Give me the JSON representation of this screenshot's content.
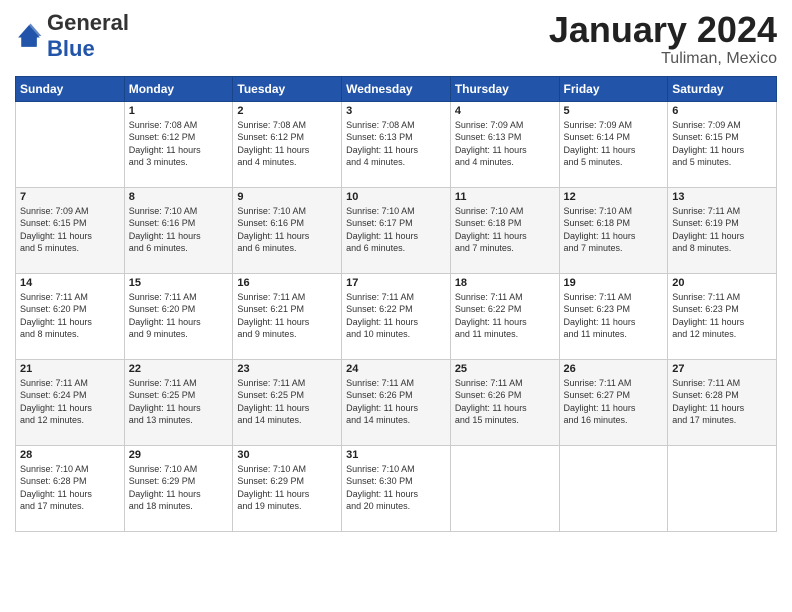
{
  "header": {
    "logo": {
      "general": "General",
      "blue": "Blue"
    },
    "title": "January 2024",
    "subtitle": "Tuliman, Mexico"
  },
  "calendar": {
    "days_of_week": [
      "Sunday",
      "Monday",
      "Tuesday",
      "Wednesday",
      "Thursday",
      "Friday",
      "Saturday"
    ],
    "weeks": [
      [
        {
          "day": "",
          "info": ""
        },
        {
          "day": "1",
          "info": "Sunrise: 7:08 AM\nSunset: 6:12 PM\nDaylight: 11 hours\nand 3 minutes."
        },
        {
          "day": "2",
          "info": "Sunrise: 7:08 AM\nSunset: 6:12 PM\nDaylight: 11 hours\nand 4 minutes."
        },
        {
          "day": "3",
          "info": "Sunrise: 7:08 AM\nSunset: 6:13 PM\nDaylight: 11 hours\nand 4 minutes."
        },
        {
          "day": "4",
          "info": "Sunrise: 7:09 AM\nSunset: 6:13 PM\nDaylight: 11 hours\nand 4 minutes."
        },
        {
          "day": "5",
          "info": "Sunrise: 7:09 AM\nSunset: 6:14 PM\nDaylight: 11 hours\nand 5 minutes."
        },
        {
          "day": "6",
          "info": "Sunrise: 7:09 AM\nSunset: 6:15 PM\nDaylight: 11 hours\nand 5 minutes."
        }
      ],
      [
        {
          "day": "7",
          "info": "Sunrise: 7:09 AM\nSunset: 6:15 PM\nDaylight: 11 hours\nand 5 minutes."
        },
        {
          "day": "8",
          "info": "Sunrise: 7:10 AM\nSunset: 6:16 PM\nDaylight: 11 hours\nand 6 minutes."
        },
        {
          "day": "9",
          "info": "Sunrise: 7:10 AM\nSunset: 6:16 PM\nDaylight: 11 hours\nand 6 minutes."
        },
        {
          "day": "10",
          "info": "Sunrise: 7:10 AM\nSunset: 6:17 PM\nDaylight: 11 hours\nand 6 minutes."
        },
        {
          "day": "11",
          "info": "Sunrise: 7:10 AM\nSunset: 6:18 PM\nDaylight: 11 hours\nand 7 minutes."
        },
        {
          "day": "12",
          "info": "Sunrise: 7:10 AM\nSunset: 6:18 PM\nDaylight: 11 hours\nand 7 minutes."
        },
        {
          "day": "13",
          "info": "Sunrise: 7:11 AM\nSunset: 6:19 PM\nDaylight: 11 hours\nand 8 minutes."
        }
      ],
      [
        {
          "day": "14",
          "info": "Sunrise: 7:11 AM\nSunset: 6:20 PM\nDaylight: 11 hours\nand 8 minutes."
        },
        {
          "day": "15",
          "info": "Sunrise: 7:11 AM\nSunset: 6:20 PM\nDaylight: 11 hours\nand 9 minutes."
        },
        {
          "day": "16",
          "info": "Sunrise: 7:11 AM\nSunset: 6:21 PM\nDaylight: 11 hours\nand 9 minutes."
        },
        {
          "day": "17",
          "info": "Sunrise: 7:11 AM\nSunset: 6:22 PM\nDaylight: 11 hours\nand 10 minutes."
        },
        {
          "day": "18",
          "info": "Sunrise: 7:11 AM\nSunset: 6:22 PM\nDaylight: 11 hours\nand 11 minutes."
        },
        {
          "day": "19",
          "info": "Sunrise: 7:11 AM\nSunset: 6:23 PM\nDaylight: 11 hours\nand 11 minutes."
        },
        {
          "day": "20",
          "info": "Sunrise: 7:11 AM\nSunset: 6:23 PM\nDaylight: 11 hours\nand 12 minutes."
        }
      ],
      [
        {
          "day": "21",
          "info": "Sunrise: 7:11 AM\nSunset: 6:24 PM\nDaylight: 11 hours\nand 12 minutes."
        },
        {
          "day": "22",
          "info": "Sunrise: 7:11 AM\nSunset: 6:25 PM\nDaylight: 11 hours\nand 13 minutes."
        },
        {
          "day": "23",
          "info": "Sunrise: 7:11 AM\nSunset: 6:25 PM\nDaylight: 11 hours\nand 14 minutes."
        },
        {
          "day": "24",
          "info": "Sunrise: 7:11 AM\nSunset: 6:26 PM\nDaylight: 11 hours\nand 14 minutes."
        },
        {
          "day": "25",
          "info": "Sunrise: 7:11 AM\nSunset: 6:26 PM\nDaylight: 11 hours\nand 15 minutes."
        },
        {
          "day": "26",
          "info": "Sunrise: 7:11 AM\nSunset: 6:27 PM\nDaylight: 11 hours\nand 16 minutes."
        },
        {
          "day": "27",
          "info": "Sunrise: 7:11 AM\nSunset: 6:28 PM\nDaylight: 11 hours\nand 17 minutes."
        }
      ],
      [
        {
          "day": "28",
          "info": "Sunrise: 7:10 AM\nSunset: 6:28 PM\nDaylight: 11 hours\nand 17 minutes."
        },
        {
          "day": "29",
          "info": "Sunrise: 7:10 AM\nSunset: 6:29 PM\nDaylight: 11 hours\nand 18 minutes."
        },
        {
          "day": "30",
          "info": "Sunrise: 7:10 AM\nSunset: 6:29 PM\nDaylight: 11 hours\nand 19 minutes."
        },
        {
          "day": "31",
          "info": "Sunrise: 7:10 AM\nSunset: 6:30 PM\nDaylight: 11 hours\nand 20 minutes."
        },
        {
          "day": "",
          "info": ""
        },
        {
          "day": "",
          "info": ""
        },
        {
          "day": "",
          "info": ""
        }
      ]
    ]
  }
}
